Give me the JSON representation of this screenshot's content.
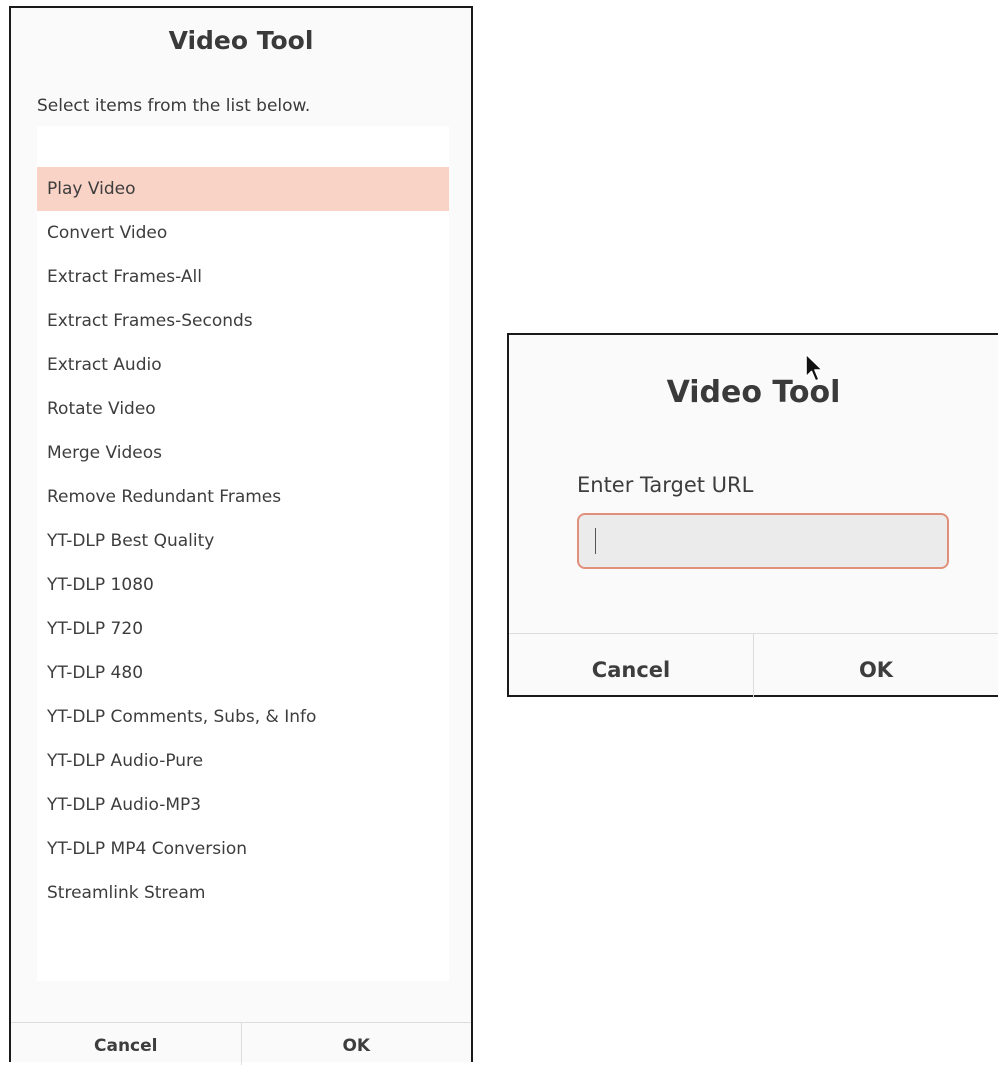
{
  "list_dialog": {
    "title": "Video Tool",
    "prompt": "Select items from the list below.",
    "selected_index": 0,
    "items": [
      "Play Video",
      "Convert Video",
      "Extract Frames-All",
      "Extract Frames-Seconds",
      "Extract Audio",
      "Rotate Video",
      "Merge Videos",
      "Remove Redundant Frames",
      "YT-DLP Best Quality",
      "YT-DLP 1080",
      "YT-DLP 720",
      "YT-DLP 480",
      "YT-DLP Comments, Subs, & Info",
      "YT-DLP Audio-Pure",
      "YT-DLP Audio-MP3",
      "YT-DLP MP4 Conversion",
      "Streamlink Stream"
    ],
    "cancel_label": "Cancel",
    "ok_label": "OK"
  },
  "url_dialog": {
    "title": "Video Tool",
    "label": "Enter Target URL",
    "input_value": "",
    "cancel_label": "Cancel",
    "ok_label": "OK"
  },
  "colors": {
    "selection": "#f9d3c6",
    "input_focus_border": "#e0907a",
    "dialog_background": "#fafafa"
  },
  "icons": {
    "cursor": "mouse-pointer-icon"
  }
}
